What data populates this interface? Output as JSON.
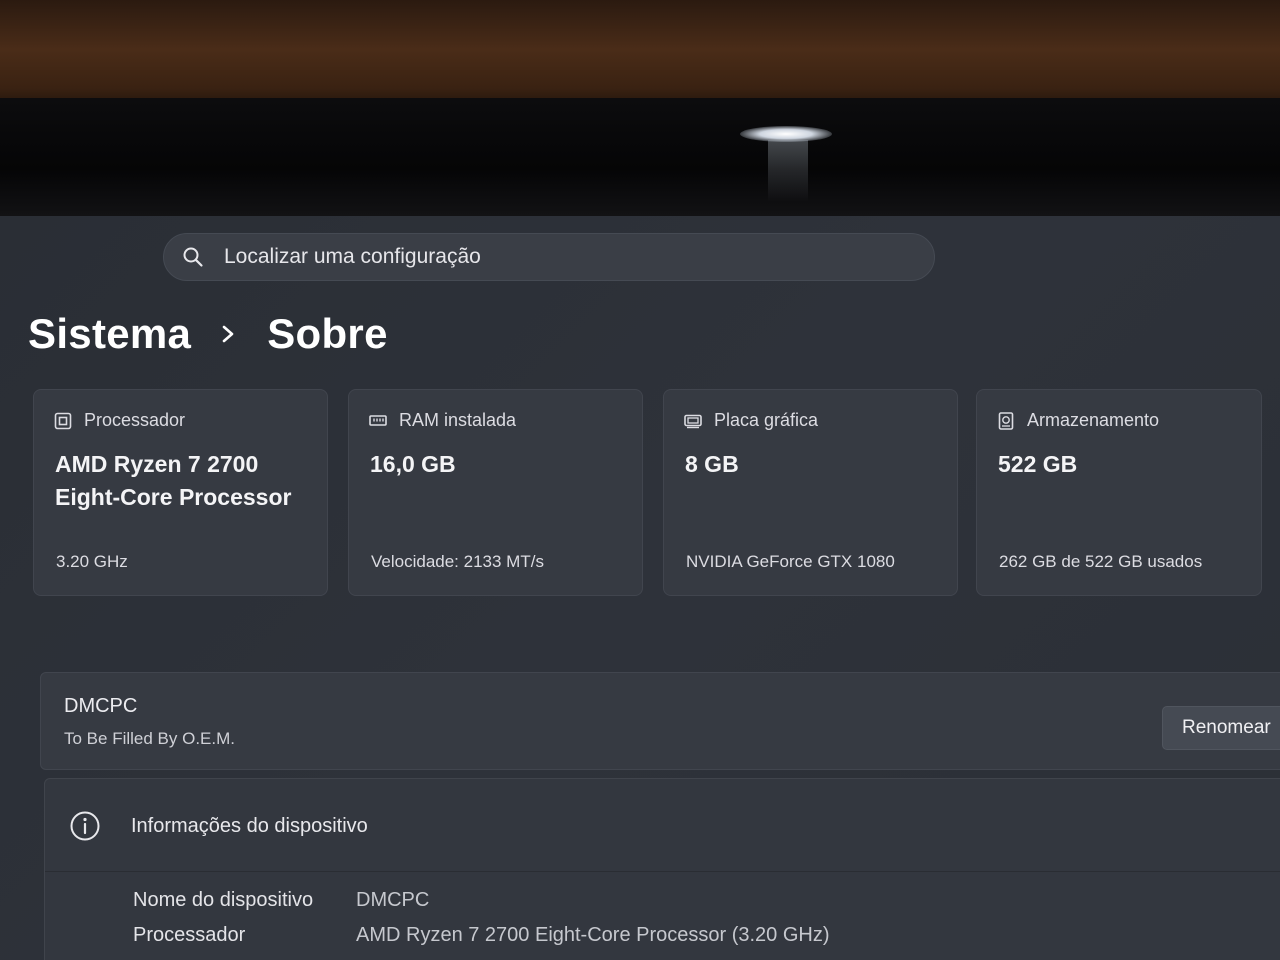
{
  "search": {
    "placeholder": "Localizar uma configuração",
    "icon": "search-icon"
  },
  "breadcrumb": {
    "parent": "Sistema",
    "current": "Sobre"
  },
  "cards": [
    {
      "icon": "cpu-chip-icon",
      "title": "Processador",
      "value": "AMD Ryzen 7 2700 Eight-Core Processor",
      "sub": "3.20 GHz"
    },
    {
      "icon": "ram-module-icon",
      "title": "RAM instalada",
      "value": "16,0 GB",
      "sub": "Velocidade: 2133 MT/s"
    },
    {
      "icon": "graphics-card-icon",
      "title": "Placa gráfica",
      "value": "8 GB",
      "sub": "NVIDIA GeForce GTX 1080"
    },
    {
      "icon": "storage-drive-icon",
      "title": "Armazenamento",
      "value": "522 GB",
      "sub": "262 GB de 522 GB usados"
    }
  ],
  "device": {
    "name": "DMCPC",
    "model": "To Be Filled By O.E.M.",
    "rename_label": "Renomear"
  },
  "info": {
    "title": "Informações do dispositivo",
    "icon": "info-circle-icon",
    "rows": [
      {
        "label": "Nome do dispositivo",
        "value": "DMCPC"
      },
      {
        "label": "Processador",
        "value": "AMD Ryzen 7 2700 Eight-Core Processor (3.20 GHz)"
      }
    ]
  },
  "colors": {
    "background": "#2c3037",
    "card": "#363a42",
    "text": "#e8e8ec"
  }
}
